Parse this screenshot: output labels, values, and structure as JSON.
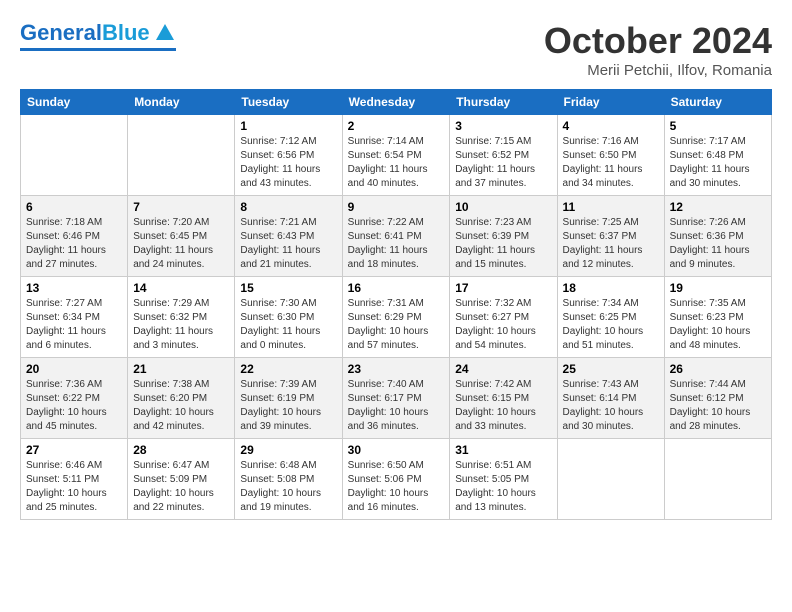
{
  "header": {
    "logo_general": "General",
    "logo_blue": "Blue",
    "month_year": "October 2024",
    "location": "Merii Petchii, Ilfov, Romania"
  },
  "days_of_week": [
    "Sunday",
    "Monday",
    "Tuesday",
    "Wednesday",
    "Thursday",
    "Friday",
    "Saturday"
  ],
  "weeks": [
    [
      {
        "day": "",
        "sunrise": "",
        "sunset": "",
        "daylight": ""
      },
      {
        "day": "",
        "sunrise": "",
        "sunset": "",
        "daylight": ""
      },
      {
        "day": "1",
        "sunrise": "Sunrise: 7:12 AM",
        "sunset": "Sunset: 6:56 PM",
        "daylight": "Daylight: 11 hours and 43 minutes."
      },
      {
        "day": "2",
        "sunrise": "Sunrise: 7:14 AM",
        "sunset": "Sunset: 6:54 PM",
        "daylight": "Daylight: 11 hours and 40 minutes."
      },
      {
        "day": "3",
        "sunrise": "Sunrise: 7:15 AM",
        "sunset": "Sunset: 6:52 PM",
        "daylight": "Daylight: 11 hours and 37 minutes."
      },
      {
        "day": "4",
        "sunrise": "Sunrise: 7:16 AM",
        "sunset": "Sunset: 6:50 PM",
        "daylight": "Daylight: 11 hours and 34 minutes."
      },
      {
        "day": "5",
        "sunrise": "Sunrise: 7:17 AM",
        "sunset": "Sunset: 6:48 PM",
        "daylight": "Daylight: 11 hours and 30 minutes."
      }
    ],
    [
      {
        "day": "6",
        "sunrise": "Sunrise: 7:18 AM",
        "sunset": "Sunset: 6:46 PM",
        "daylight": "Daylight: 11 hours and 27 minutes."
      },
      {
        "day": "7",
        "sunrise": "Sunrise: 7:20 AM",
        "sunset": "Sunset: 6:45 PM",
        "daylight": "Daylight: 11 hours and 24 minutes."
      },
      {
        "day": "8",
        "sunrise": "Sunrise: 7:21 AM",
        "sunset": "Sunset: 6:43 PM",
        "daylight": "Daylight: 11 hours and 21 minutes."
      },
      {
        "day": "9",
        "sunrise": "Sunrise: 7:22 AM",
        "sunset": "Sunset: 6:41 PM",
        "daylight": "Daylight: 11 hours and 18 minutes."
      },
      {
        "day": "10",
        "sunrise": "Sunrise: 7:23 AM",
        "sunset": "Sunset: 6:39 PM",
        "daylight": "Daylight: 11 hours and 15 minutes."
      },
      {
        "day": "11",
        "sunrise": "Sunrise: 7:25 AM",
        "sunset": "Sunset: 6:37 PM",
        "daylight": "Daylight: 11 hours and 12 minutes."
      },
      {
        "day": "12",
        "sunrise": "Sunrise: 7:26 AM",
        "sunset": "Sunset: 6:36 PM",
        "daylight": "Daylight: 11 hours and 9 minutes."
      }
    ],
    [
      {
        "day": "13",
        "sunrise": "Sunrise: 7:27 AM",
        "sunset": "Sunset: 6:34 PM",
        "daylight": "Daylight: 11 hours and 6 minutes."
      },
      {
        "day": "14",
        "sunrise": "Sunrise: 7:29 AM",
        "sunset": "Sunset: 6:32 PM",
        "daylight": "Daylight: 11 hours and 3 minutes."
      },
      {
        "day": "15",
        "sunrise": "Sunrise: 7:30 AM",
        "sunset": "Sunset: 6:30 PM",
        "daylight": "Daylight: 11 hours and 0 minutes."
      },
      {
        "day": "16",
        "sunrise": "Sunrise: 7:31 AM",
        "sunset": "Sunset: 6:29 PM",
        "daylight": "Daylight: 10 hours and 57 minutes."
      },
      {
        "day": "17",
        "sunrise": "Sunrise: 7:32 AM",
        "sunset": "Sunset: 6:27 PM",
        "daylight": "Daylight: 10 hours and 54 minutes."
      },
      {
        "day": "18",
        "sunrise": "Sunrise: 7:34 AM",
        "sunset": "Sunset: 6:25 PM",
        "daylight": "Daylight: 10 hours and 51 minutes."
      },
      {
        "day": "19",
        "sunrise": "Sunrise: 7:35 AM",
        "sunset": "Sunset: 6:23 PM",
        "daylight": "Daylight: 10 hours and 48 minutes."
      }
    ],
    [
      {
        "day": "20",
        "sunrise": "Sunrise: 7:36 AM",
        "sunset": "Sunset: 6:22 PM",
        "daylight": "Daylight: 10 hours and 45 minutes."
      },
      {
        "day": "21",
        "sunrise": "Sunrise: 7:38 AM",
        "sunset": "Sunset: 6:20 PM",
        "daylight": "Daylight: 10 hours and 42 minutes."
      },
      {
        "day": "22",
        "sunrise": "Sunrise: 7:39 AM",
        "sunset": "Sunset: 6:19 PM",
        "daylight": "Daylight: 10 hours and 39 minutes."
      },
      {
        "day": "23",
        "sunrise": "Sunrise: 7:40 AM",
        "sunset": "Sunset: 6:17 PM",
        "daylight": "Daylight: 10 hours and 36 minutes."
      },
      {
        "day": "24",
        "sunrise": "Sunrise: 7:42 AM",
        "sunset": "Sunset: 6:15 PM",
        "daylight": "Daylight: 10 hours and 33 minutes."
      },
      {
        "day": "25",
        "sunrise": "Sunrise: 7:43 AM",
        "sunset": "Sunset: 6:14 PM",
        "daylight": "Daylight: 10 hours and 30 minutes."
      },
      {
        "day": "26",
        "sunrise": "Sunrise: 7:44 AM",
        "sunset": "Sunset: 6:12 PM",
        "daylight": "Daylight: 10 hours and 28 minutes."
      }
    ],
    [
      {
        "day": "27",
        "sunrise": "Sunrise: 6:46 AM",
        "sunset": "Sunset: 5:11 PM",
        "daylight": "Daylight: 10 hours and 25 minutes."
      },
      {
        "day": "28",
        "sunrise": "Sunrise: 6:47 AM",
        "sunset": "Sunset: 5:09 PM",
        "daylight": "Daylight: 10 hours and 22 minutes."
      },
      {
        "day": "29",
        "sunrise": "Sunrise: 6:48 AM",
        "sunset": "Sunset: 5:08 PM",
        "daylight": "Daylight: 10 hours and 19 minutes."
      },
      {
        "day": "30",
        "sunrise": "Sunrise: 6:50 AM",
        "sunset": "Sunset: 5:06 PM",
        "daylight": "Daylight: 10 hours and 16 minutes."
      },
      {
        "day": "31",
        "sunrise": "Sunrise: 6:51 AM",
        "sunset": "Sunset: 5:05 PM",
        "daylight": "Daylight: 10 hours and 13 minutes."
      },
      {
        "day": "",
        "sunrise": "",
        "sunset": "",
        "daylight": ""
      },
      {
        "day": "",
        "sunrise": "",
        "sunset": "",
        "daylight": ""
      }
    ]
  ]
}
